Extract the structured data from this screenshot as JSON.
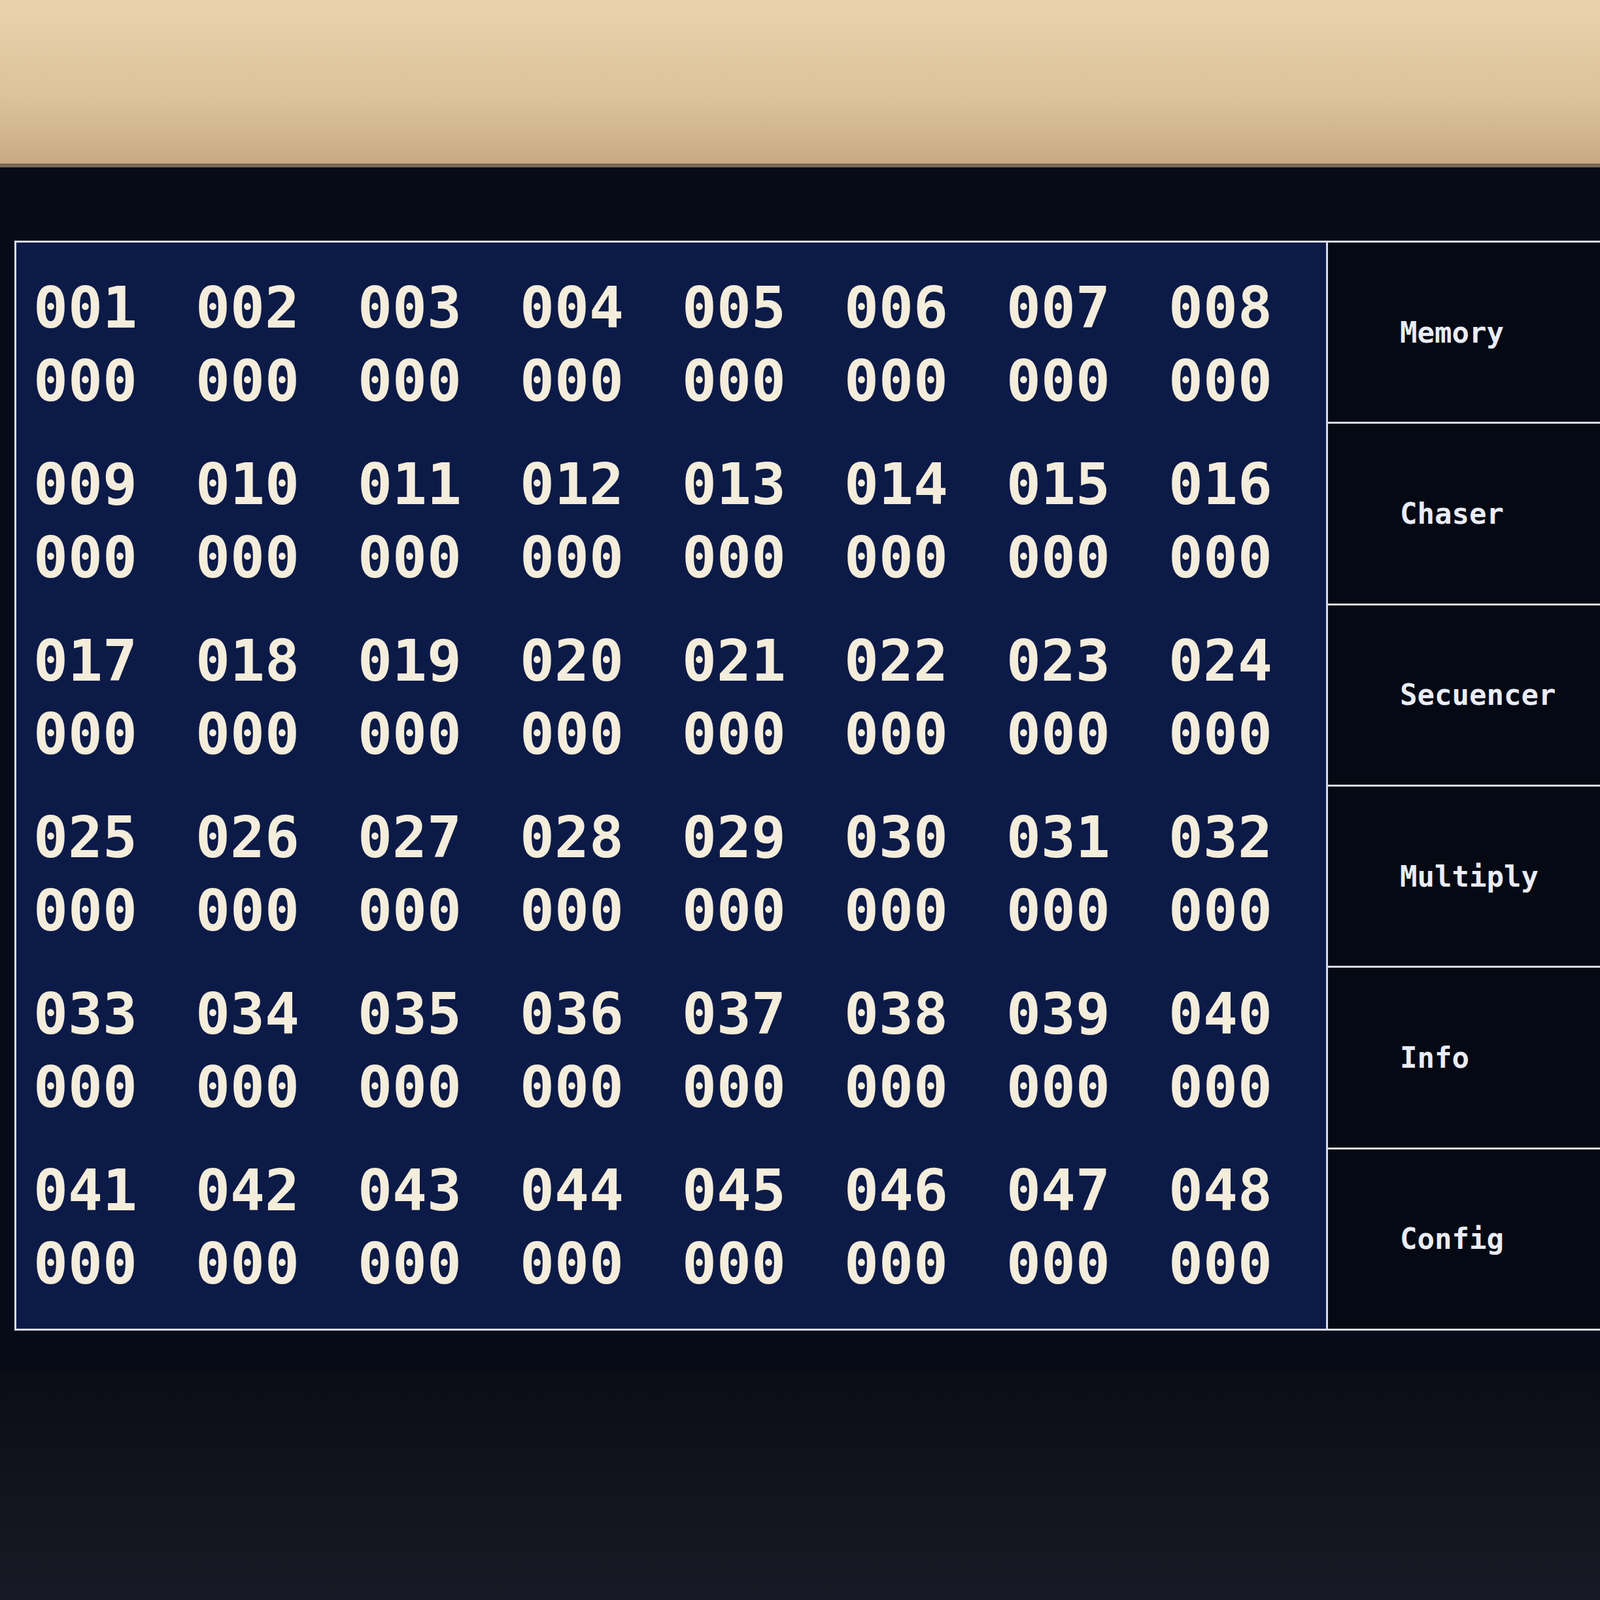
{
  "screen": {
    "channels": [
      {
        "number": "001",
        "value": "000"
      },
      {
        "number": "002",
        "value": "000"
      },
      {
        "number": "003",
        "value": "000"
      },
      {
        "number": "004",
        "value": "000"
      },
      {
        "number": "005",
        "value": "000"
      },
      {
        "number": "006",
        "value": "000"
      },
      {
        "number": "007",
        "value": "000"
      },
      {
        "number": "008",
        "value": "000"
      },
      {
        "number": "009",
        "value": "000"
      },
      {
        "number": "010",
        "value": "000"
      },
      {
        "number": "011",
        "value": "000"
      },
      {
        "number": "012",
        "value": "000"
      },
      {
        "number": "013",
        "value": "000"
      },
      {
        "number": "014",
        "value": "000"
      },
      {
        "number": "015",
        "value": "000"
      },
      {
        "number": "016",
        "value": "000"
      },
      {
        "number": "017",
        "value": "000"
      },
      {
        "number": "018",
        "value": "000"
      },
      {
        "number": "019",
        "value": "000"
      },
      {
        "number": "020",
        "value": "000"
      },
      {
        "number": "021",
        "value": "000"
      },
      {
        "number": "022",
        "value": "000"
      },
      {
        "number": "023",
        "value": "000"
      },
      {
        "number": "024",
        "value": "000"
      },
      {
        "number": "025",
        "value": "000"
      },
      {
        "number": "026",
        "value": "000"
      },
      {
        "number": "027",
        "value": "000"
      },
      {
        "number": "028",
        "value": "000"
      },
      {
        "number": "029",
        "value": "000"
      },
      {
        "number": "030",
        "value": "000"
      },
      {
        "number": "031",
        "value": "000"
      },
      {
        "number": "032",
        "value": "000"
      },
      {
        "number": "033",
        "value": "000"
      },
      {
        "number": "034",
        "value": "000"
      },
      {
        "number": "035",
        "value": "000"
      },
      {
        "number": "036",
        "value": "000"
      },
      {
        "number": "037",
        "value": "000"
      },
      {
        "number": "038",
        "value": "000"
      },
      {
        "number": "039",
        "value": "000"
      },
      {
        "number": "040",
        "value": "000"
      },
      {
        "number": "041",
        "value": "000"
      },
      {
        "number": "042",
        "value": "000"
      },
      {
        "number": "043",
        "value": "000"
      },
      {
        "number": "044",
        "value": "000"
      },
      {
        "number": "045",
        "value": "000"
      },
      {
        "number": "046",
        "value": "000"
      },
      {
        "number": "047",
        "value": "000"
      },
      {
        "number": "048",
        "value": "000"
      }
    ],
    "menu": [
      {
        "label": "Memory"
      },
      {
        "label": "Chaser"
      },
      {
        "label": "Secuencer"
      },
      {
        "label": "Multiply"
      },
      {
        "label": "Info"
      },
      {
        "label": "Config"
      }
    ]
  }
}
